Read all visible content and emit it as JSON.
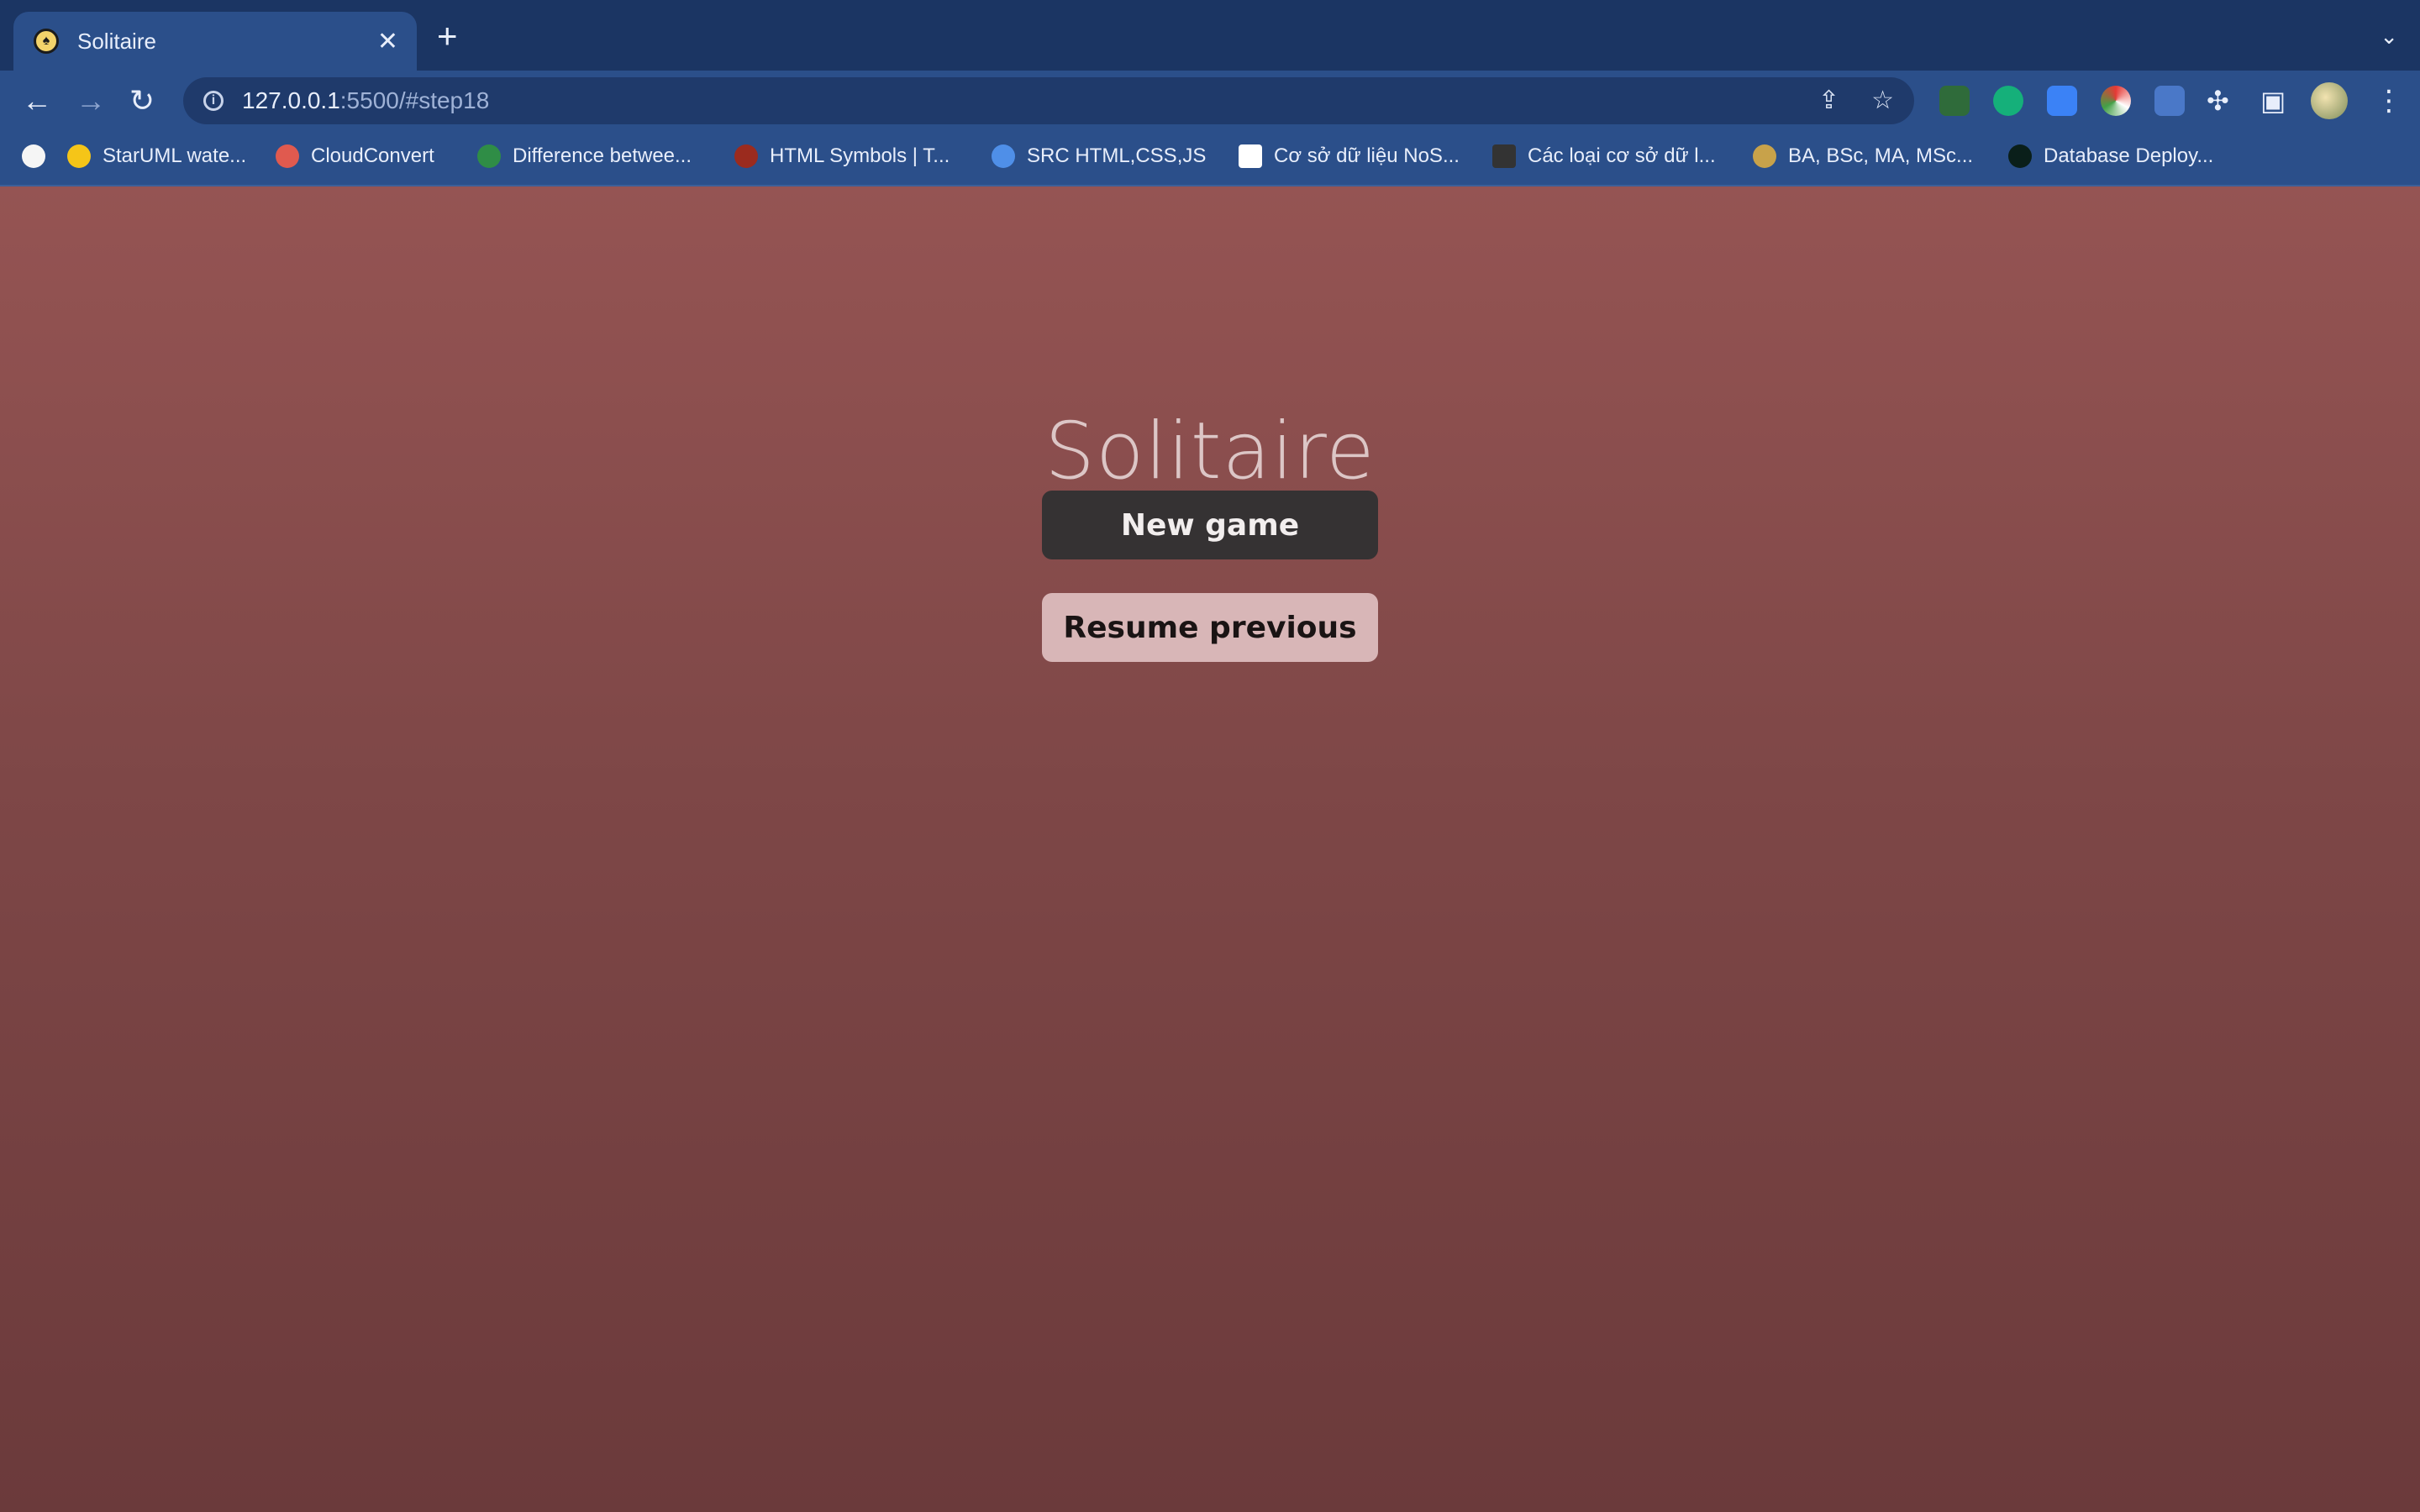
{
  "browser": {
    "tab_title": "Solitaire",
    "tab_close": "✕",
    "new_tab": "+",
    "tab_menu": "⌄",
    "url_host": "127.0.0.1",
    "url_rest": ":5500/#step18",
    "bookmarks": [
      {
        "label": "StarUML wate...",
        "icon": "github-star-icon"
      },
      {
        "label": "CloudConvert",
        "icon": "cloudconvert-icon"
      },
      {
        "label": "Difference betwee...",
        "icon": "geeksforgeeks-icon"
      },
      {
        "label": "HTML Symbols | T...",
        "icon": "w3schools-icon"
      },
      {
        "label": "SRC HTML,CSS,JS",
        "icon": "cn-icon"
      },
      {
        "label": "Cơ sở dữ liệu NoS...",
        "icon": "page-icon"
      },
      {
        "label": "Các loại cơ sở dữ l...",
        "icon": "dark-page-icon"
      },
      {
        "label": "BA, BSc, MA, MSc...",
        "icon": "crest-icon"
      },
      {
        "label": "Database Deploy...",
        "icon": "mongodb-leaf-icon"
      }
    ]
  },
  "page": {
    "title": "Solitaire",
    "new_game_label": "New game",
    "resume_label": "Resume previous"
  },
  "colors": {
    "page_top": "#955453",
    "page_bottom": "#6b3a3b",
    "new_game_bg": "#353233",
    "resume_bg": "#d8b6b7"
  }
}
